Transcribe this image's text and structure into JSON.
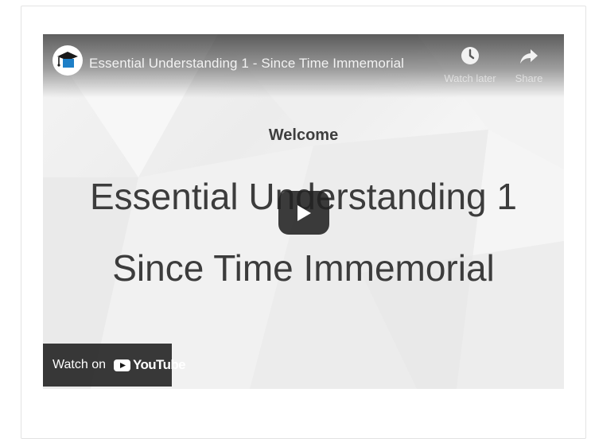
{
  "video": {
    "title": "Essential Understanding 1 - Since Time Immemorial",
    "channel_avatar_icon": "graduation-cap-icon",
    "actions": {
      "watch_later_label": "Watch later",
      "share_label": "Share"
    }
  },
  "slide": {
    "welcome": "Welcome",
    "line1": "Essential Understanding 1",
    "line2": "Since Time Immemorial"
  },
  "watch_on": {
    "label": "Watch on",
    "brand": "YouTube"
  },
  "colors": {
    "youtube_red": "#ff0000",
    "avatar_blue": "#1e7fc7"
  }
}
